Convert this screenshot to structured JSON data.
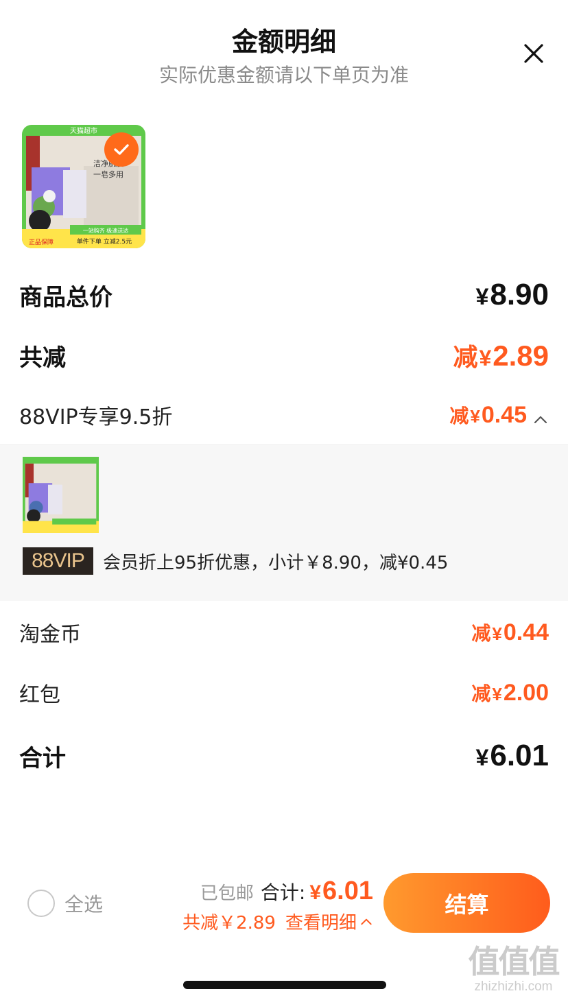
{
  "header": {
    "title": "金额明细",
    "subtitle": "实际优惠金额请以下单页为准",
    "close_icon": "close-icon"
  },
  "product": {
    "image_banner": "天猫超市",
    "image_slogan_1": "洁净肌肤",
    "image_slogan_2": "一皂多用",
    "image_bottom_1": "一站购齐 极速送达",
    "image_bottom_2": "单件下单 立减2.5元",
    "image_corner": "正品保障",
    "selected": true
  },
  "rows": {
    "subtotal": {
      "label": "商品总价",
      "symbol": "¥",
      "value": "8.90"
    },
    "discount_total": {
      "label": "共减",
      "prefix": "减",
      "symbol": "¥",
      "value": "2.89"
    },
    "vip": {
      "label": "88VIP专享9.5折",
      "prefix": "减",
      "symbol": "¥",
      "value": "0.45",
      "expanded": true
    },
    "coins": {
      "label": "淘金币",
      "prefix": "减",
      "symbol": "¥",
      "value": "0.44"
    },
    "redpacket": {
      "label": "红包",
      "prefix": "减",
      "symbol": "¥",
      "value": "2.00"
    },
    "grand_total": {
      "label": "合计",
      "symbol": "¥",
      "value": "6.01"
    }
  },
  "vip_detail": {
    "badge": "88VIP",
    "text": "会员折上95折优惠，小计￥8.90，减¥0.45"
  },
  "bottom_bar": {
    "select_all": "全选",
    "shipping": "已包邮",
    "total_label": "合计:",
    "total_symbol": "¥",
    "total_value": "6.01",
    "saved_text": "共减￥2.89",
    "detail_link": "查看明细",
    "checkout": "结算"
  },
  "watermark": {
    "glyphs": "值值值",
    "site": "zhizhizhi.com"
  },
  "colors": {
    "accent": "#ff5a1f",
    "button_gradient_start": "#ff9a2e",
    "button_gradient_end": "#ff5c1c",
    "vip_badge_bg": "#2a2420",
    "vip_badge_text": "#e8c38c"
  }
}
